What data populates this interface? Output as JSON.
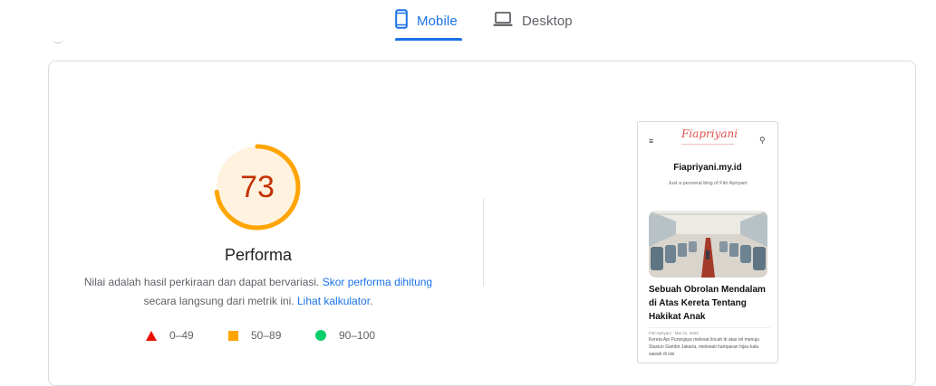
{
  "tabs": {
    "mobile": {
      "label": "Mobile",
      "icon": "smartphone-icon",
      "active": true
    },
    "desktop": {
      "label": "Desktop",
      "icon": "laptop-icon",
      "active": false
    }
  },
  "score": {
    "value": "73",
    "fraction": 0.73,
    "title": "Performa",
    "color": "#c33300",
    "ring_color": "#ffa400",
    "ring_bg": "#fff3e0"
  },
  "description": {
    "text_before": "Nilai adalah hasil perkiraan dan dapat bervariasi. ",
    "link1": "Skor performa dihitung",
    "text_middle": " secara langsung dari metrik ini. ",
    "link2": "Lihat kalkulator",
    "text_after": "."
  },
  "legend": {
    "fail": {
      "label": "0–49",
      "color": "#eb0f00",
      "icon": "triangle-icon"
    },
    "average": {
      "label": "50–89",
      "color": "#ffa400",
      "icon": "square-icon"
    },
    "pass": {
      "label": "90–100",
      "color": "#0cce6b",
      "icon": "circle-icon"
    }
  },
  "screenshot": {
    "menu_icon": "≡",
    "logo": "Fiapriyani",
    "search_icon": "⚲",
    "site_name": "Fiapriyani.my.id",
    "tagline": "Just a personal blog of Fitri Apriyani",
    "post_title": "Sebuah Obrolan Mendalam di Atas Kereta Tentang Hakikat Anak",
    "post_meta": "Fitri Apriyani · Mei 21, 2023",
    "post_excerpt": "Kereta Api Purwojaya melesat lincah di atas rel menuju Stasiun Gambir Jakarta, melewati hamparan hijau kala sawah di sisi"
  }
}
